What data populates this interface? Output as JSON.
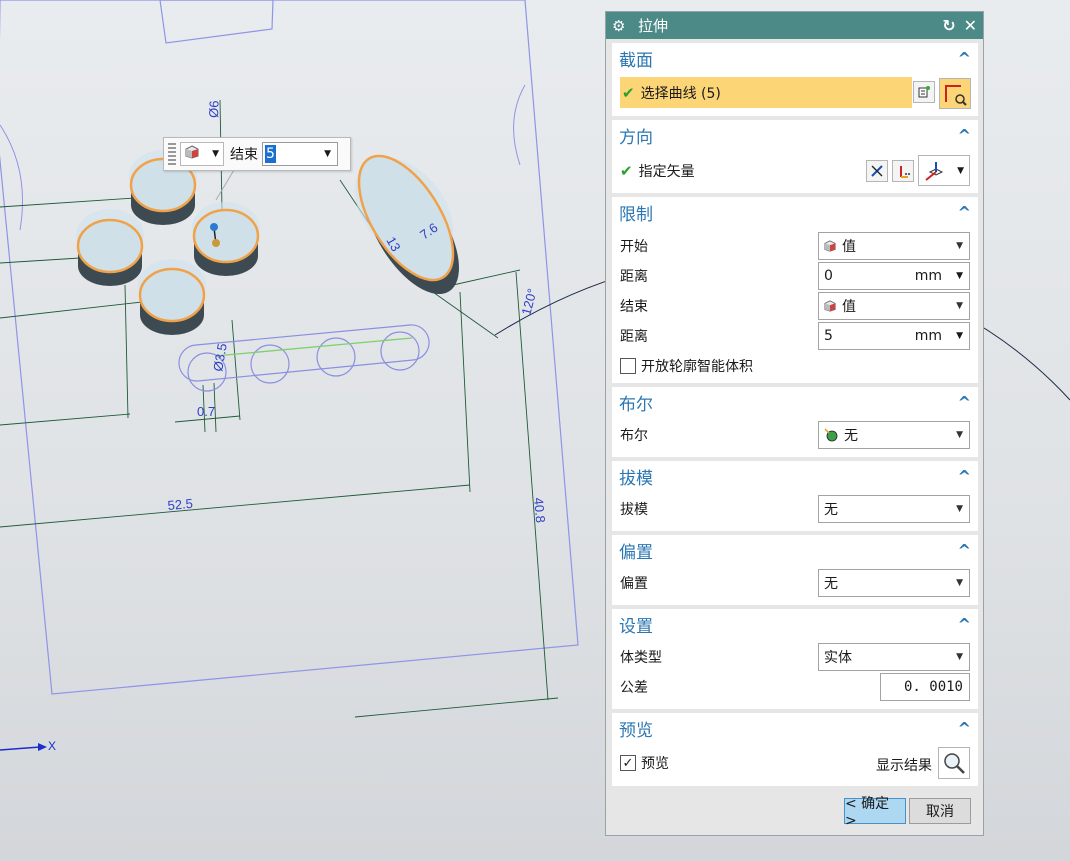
{
  "viewport": {
    "axis_label": "X",
    "dims": [
      "Ø6",
      "13",
      "7.6",
      "120°",
      "Ø3.5",
      "0.7",
      "52.5",
      "40.8"
    ]
  },
  "float_bar": {
    "label": "结束",
    "value": "5"
  },
  "dialog": {
    "title": "拉伸",
    "section": {
      "title": "截面",
      "select_curve": "选择曲线 (5)"
    },
    "direction": {
      "title": "方向",
      "vector_label": "指定矢量"
    },
    "limits": {
      "title": "限制",
      "start_label": "开始",
      "start_value": "值",
      "distance1_label": "距离",
      "distance1_value": "0",
      "distance1_unit": "mm",
      "end_label": "结束",
      "end_value": "值",
      "distance2_label": "距离",
      "distance2_value": "5",
      "distance2_unit": "mm",
      "open_profile_label": "开放轮廓智能体积",
      "open_profile_checked": false
    },
    "boolean": {
      "title": "布尔",
      "label": "布尔",
      "value": "无"
    },
    "draft": {
      "title": "拔模",
      "label": "拔模",
      "value": "无"
    },
    "offset": {
      "title": "偏置",
      "label": "偏置",
      "value": "无"
    },
    "settings": {
      "title": "设置",
      "body_type_label": "体类型",
      "body_type_value": "实体",
      "tolerance_label": "公差",
      "tolerance_value": "0. 0010"
    },
    "preview": {
      "title": "预览",
      "checkbox_label": "预览",
      "checked": true,
      "show_result_label": "显示结果"
    },
    "ok_label": "< 确定 >",
    "cancel_label": "取消"
  },
  "colors": {
    "title_bar": "#4c8a87",
    "section_title": "#2b77b3",
    "selection_highlight": "#fbd576",
    "ok_button": "#aed8f2",
    "sketch_line": "#8b8fe0",
    "highlight_edge": "#f0a24a"
  }
}
